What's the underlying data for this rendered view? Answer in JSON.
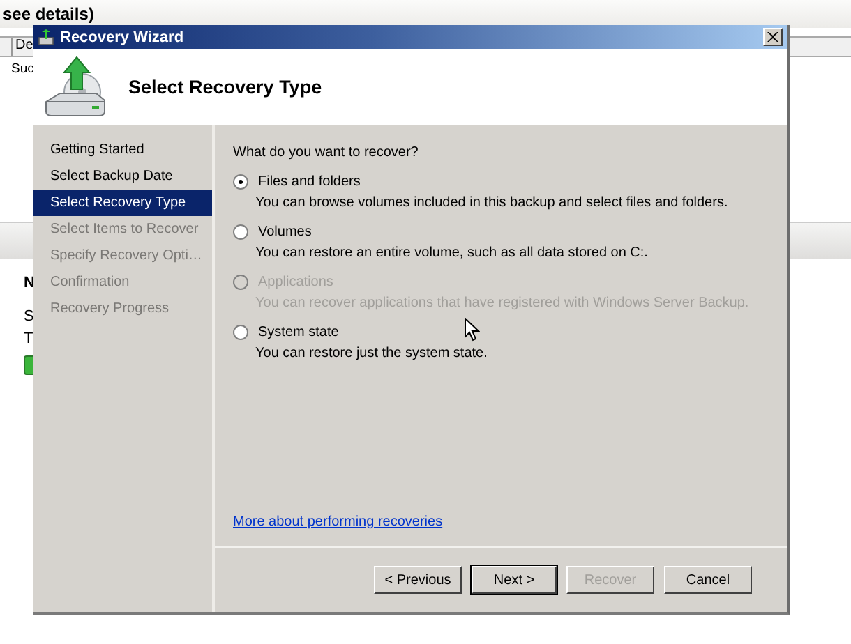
{
  "background": {
    "heading": "see details)",
    "table_header": "De",
    "table_cell": "Suc",
    "section_label": "N",
    "lines": [
      "S",
      "T"
    ]
  },
  "dialog": {
    "title": "Recovery Wizard",
    "header": "Select Recovery Type",
    "steps": [
      {
        "label": "Getting Started",
        "selected": false,
        "disabled": false
      },
      {
        "label": "Select Backup Date",
        "selected": false,
        "disabled": false
      },
      {
        "label": "Select Recovery Type",
        "selected": true,
        "disabled": false
      },
      {
        "label": "Select Items to Recover",
        "selected": false,
        "disabled": true
      },
      {
        "label": "Specify Recovery Opti…",
        "selected": false,
        "disabled": true
      },
      {
        "label": "Confirmation",
        "selected": false,
        "disabled": true
      },
      {
        "label": "Recovery Progress",
        "selected": false,
        "disabled": true
      }
    ],
    "question": "What do you want to recover?",
    "options": [
      {
        "label": "Files and folders",
        "description": "You can browse volumes included in this backup and select files and folders.",
        "selected": true,
        "disabled": false
      },
      {
        "label": "Volumes",
        "description": "You can restore an entire volume, such as all data stored on C:.",
        "selected": false,
        "disabled": false
      },
      {
        "label": "Applications",
        "description": "You can recover applications that have registered with Windows Server Backup.",
        "selected": false,
        "disabled": true
      },
      {
        "label": "System state",
        "description": "You can restore just the system state.",
        "selected": false,
        "disabled": false
      }
    ],
    "link": "More about performing recoveries",
    "buttons": [
      {
        "label": "< Previous",
        "disabled": false,
        "default": false
      },
      {
        "label": "Next >",
        "disabled": false,
        "default": true
      },
      {
        "label": "Recover",
        "disabled": true,
        "default": false
      },
      {
        "label": "Cancel",
        "disabled": false,
        "default": false
      }
    ]
  }
}
